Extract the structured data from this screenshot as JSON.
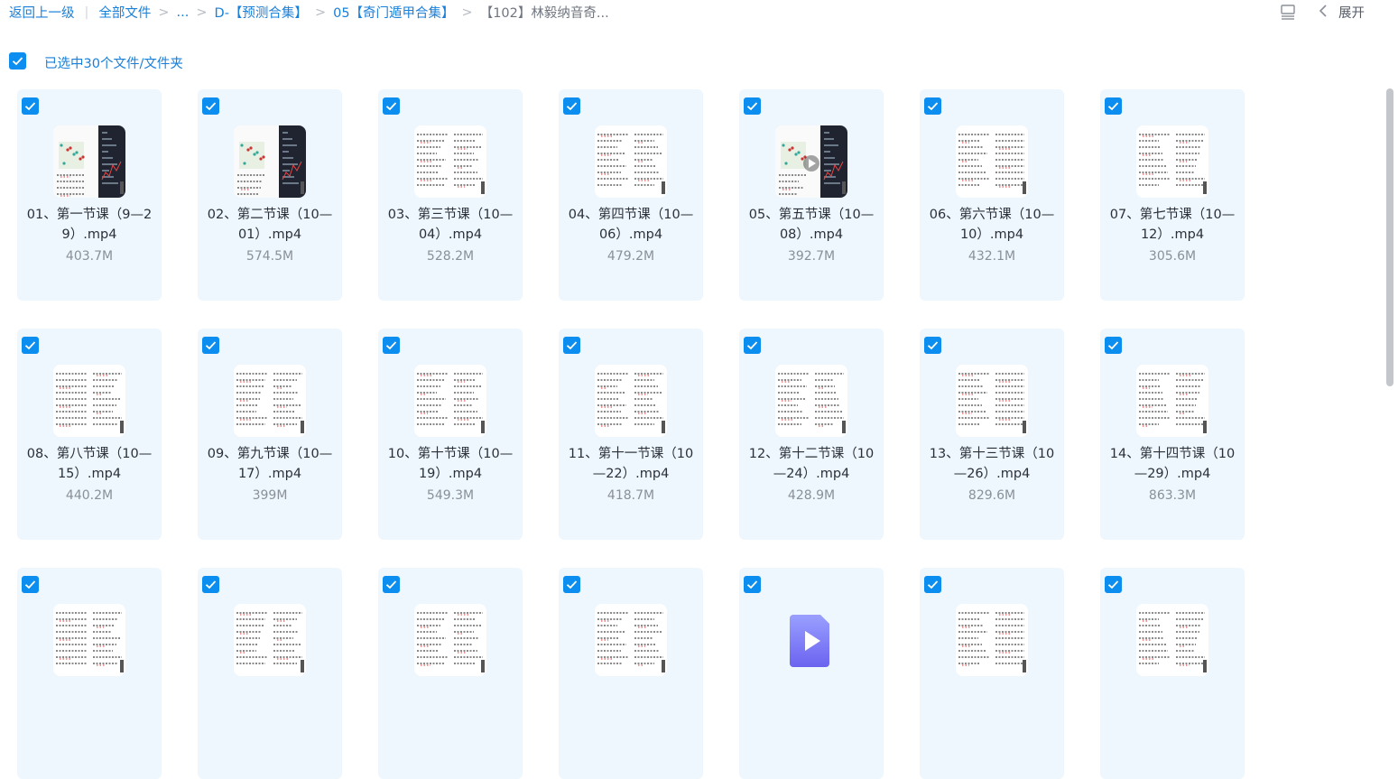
{
  "breadcrumb": {
    "back": "返回上一级",
    "items": [
      "全部文件",
      "...",
      "D-【预测合集】",
      "05【奇门遁甲合集】"
    ],
    "current": "【102】林毅纳音奇..."
  },
  "toolbar": {
    "expand_label": "展开"
  },
  "selection": {
    "label": "已选中30个文件/文件夹"
  },
  "colors": {
    "accent": "#0b8ef0",
    "card_bg": "#eef7fd",
    "link": "#1a7fd8"
  },
  "files": [
    {
      "name": "01、第一节课（9—29）.mp4",
      "size": "403.7M",
      "thumb": "split-dark"
    },
    {
      "name": "02、第二节课（10—01）.mp4",
      "size": "574.5M",
      "thumb": "split-dark"
    },
    {
      "name": "03、第三节课（10—04）.mp4",
      "size": "528.2M",
      "thumb": "doc"
    },
    {
      "name": "04、第四节课（10—06）.mp4",
      "size": "479.2M",
      "thumb": "doc"
    },
    {
      "name": "05、第五节课（10—08）.mp4",
      "size": "392.7M",
      "thumb": "split-dark-play"
    },
    {
      "name": "06、第六节课（10—10）.mp4",
      "size": "432.1M",
      "thumb": "doc"
    },
    {
      "name": "07、第七节课（10—12）.mp4",
      "size": "305.6M",
      "thumb": "doc"
    },
    {
      "name": "08、第八节课（10—15）.mp4",
      "size": "440.2M",
      "thumb": "doc"
    },
    {
      "name": "09、第九节课（10—17）.mp4",
      "size": "399M",
      "thumb": "doc"
    },
    {
      "name": "10、第十节课（10—19）.mp4",
      "size": "549.3M",
      "thumb": "doc"
    },
    {
      "name": "11、第十一节课（10—22）.mp4",
      "size": "418.7M",
      "thumb": "doc"
    },
    {
      "name": "12、第十二节课（10—24）.mp4",
      "size": "428.9M",
      "thumb": "doc"
    },
    {
      "name": "13、第十三节课（10—26）.mp4",
      "size": "829.6M",
      "thumb": "doc"
    },
    {
      "name": "14、第十四节课（10—29）.mp4",
      "size": "863.3M",
      "thumb": "doc"
    },
    {
      "thumb": "doc"
    },
    {
      "thumb": "doc"
    },
    {
      "thumb": "doc"
    },
    {
      "thumb": "doc"
    },
    {
      "thumb": "video-icon"
    },
    {
      "thumb": "doc"
    },
    {
      "thumb": "doc"
    }
  ]
}
